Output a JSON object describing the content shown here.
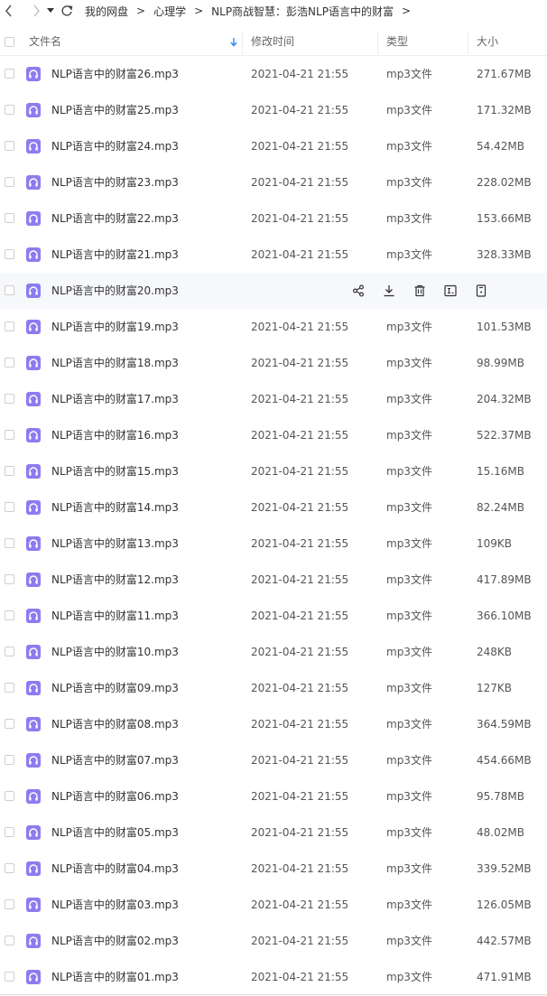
{
  "toolbar": {
    "back_icon": "chevron-left-icon",
    "forward_icon": "chevron-right-icon",
    "history_icon": "caret-down-icon",
    "refresh_icon": "refresh-icon"
  },
  "breadcrumb": {
    "items": [
      "我的网盘",
      "心理学",
      "NLP商战智慧：彭浩NLP语言中的财富"
    ],
    "separator": ">"
  },
  "columns": {
    "name": "文件名",
    "time": "修改时间",
    "type": "类型",
    "size": "大小"
  },
  "colors": {
    "file_icon": "#8c7cf0",
    "sort_arrow": "#2b8cf0",
    "hover_row": "#f7f8fb"
  },
  "hover_actions": [
    "share-icon",
    "download-icon",
    "delete-icon",
    "rename-icon",
    "more-icon"
  ],
  "files": [
    {
      "name": "NLP语言中的财富26.mp3",
      "time": "2021-04-21 21:55",
      "type": "mp3文件",
      "size": "271.67MB"
    },
    {
      "name": "NLP语言中的财富25.mp3",
      "time": "2021-04-21 21:55",
      "type": "mp3文件",
      "size": "171.32MB"
    },
    {
      "name": "NLP语言中的财富24.mp3",
      "time": "2021-04-21 21:55",
      "type": "mp3文件",
      "size": "54.42MB"
    },
    {
      "name": "NLP语言中的财富23.mp3",
      "time": "2021-04-21 21:55",
      "type": "mp3文件",
      "size": "228.02MB"
    },
    {
      "name": "NLP语言中的财富22.mp3",
      "time": "2021-04-21 21:55",
      "type": "mp3文件",
      "size": "153.66MB"
    },
    {
      "name": "NLP语言中的财富21.mp3",
      "time": "2021-04-21 21:55",
      "type": "mp3文件",
      "size": "328.33MB"
    },
    {
      "name": "NLP语言中的财富20.mp3",
      "time": "",
      "type": "",
      "size": "",
      "hover": true
    },
    {
      "name": "NLP语言中的财富19.mp3",
      "time": "2021-04-21 21:55",
      "type": "mp3文件",
      "size": "101.53MB"
    },
    {
      "name": "NLP语言中的财富18.mp3",
      "time": "2021-04-21 21:55",
      "type": "mp3文件",
      "size": "98.99MB"
    },
    {
      "name": "NLP语言中的财富17.mp3",
      "time": "2021-04-21 21:55",
      "type": "mp3文件",
      "size": "204.32MB"
    },
    {
      "name": "NLP语言中的财富16.mp3",
      "time": "2021-04-21 21:55",
      "type": "mp3文件",
      "size": "522.37MB"
    },
    {
      "name": "NLP语言中的财富15.mp3",
      "time": "2021-04-21 21:55",
      "type": "mp3文件",
      "size": "15.16MB"
    },
    {
      "name": "NLP语言中的财富14.mp3",
      "time": "2021-04-21 21:55",
      "type": "mp3文件",
      "size": "82.24MB"
    },
    {
      "name": "NLP语言中的财富13.mp3",
      "time": "2021-04-21 21:55",
      "type": "mp3文件",
      "size": "109KB"
    },
    {
      "name": "NLP语言中的财富12.mp3",
      "time": "2021-04-21 21:55",
      "type": "mp3文件",
      "size": "417.89MB"
    },
    {
      "name": "NLP语言中的财富11.mp3",
      "time": "2021-04-21 21:55",
      "type": "mp3文件",
      "size": "366.10MB"
    },
    {
      "name": "NLP语言中的财富10.mp3",
      "time": "2021-04-21 21:55",
      "type": "mp3文件",
      "size": "248KB"
    },
    {
      "name": "NLP语言中的财富09.mp3",
      "time": "2021-04-21 21:55",
      "type": "mp3文件",
      "size": "127KB"
    },
    {
      "name": "NLP语言中的财富08.mp3",
      "time": "2021-04-21 21:55",
      "type": "mp3文件",
      "size": "364.59MB"
    },
    {
      "name": "NLP语言中的财富07.mp3",
      "time": "2021-04-21 21:55",
      "type": "mp3文件",
      "size": "454.66MB"
    },
    {
      "name": "NLP语言中的财富06.mp3",
      "time": "2021-04-21 21:55",
      "type": "mp3文件",
      "size": "95.78MB"
    },
    {
      "name": "NLP语言中的财富05.mp3",
      "time": "2021-04-21 21:55",
      "type": "mp3文件",
      "size": "48.02MB"
    },
    {
      "name": "NLP语言中的财富04.mp3",
      "time": "2021-04-21 21:55",
      "type": "mp3文件",
      "size": "339.52MB"
    },
    {
      "name": "NLP语言中的财富03.mp3",
      "time": "2021-04-21 21:55",
      "type": "mp3文件",
      "size": "126.05MB"
    },
    {
      "name": "NLP语言中的财富02.mp3",
      "time": "2021-04-21 21:55",
      "type": "mp3文件",
      "size": "442.57MB"
    },
    {
      "name": "NLP语言中的财富01.mp3",
      "time": "2021-04-21 21:55",
      "type": "mp3文件",
      "size": "471.91MB"
    }
  ]
}
